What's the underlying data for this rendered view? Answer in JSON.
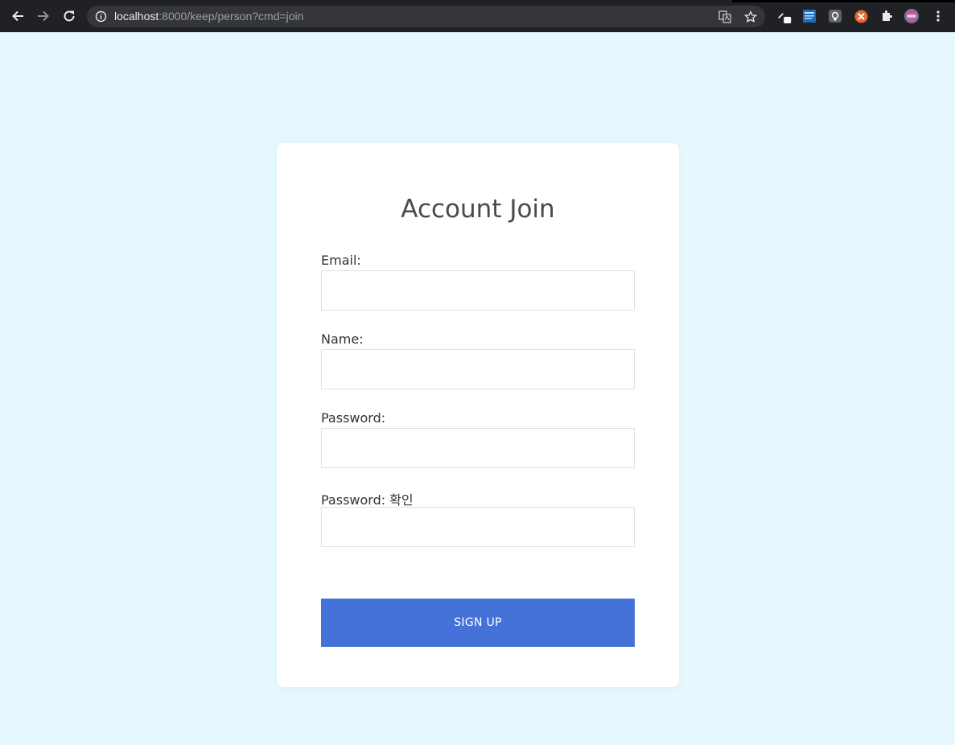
{
  "browser": {
    "url_host": "localhost",
    "url_rest": ":8000/keep/person?cmd=join"
  },
  "form": {
    "title": "Account Join",
    "fields": [
      {
        "label": "Email:",
        "value": "",
        "type": "email"
      },
      {
        "label": "Name:",
        "value": "",
        "type": "text"
      },
      {
        "label": "Password:",
        "value": "",
        "type": "password"
      },
      {
        "label": "Password: 확인",
        "value": "",
        "type": "password"
      }
    ],
    "submit_label": "SIGN UP"
  },
  "colors": {
    "page_bg": "#e6f8fd",
    "button": "#4472d8",
    "chrome_bg": "#202124"
  }
}
